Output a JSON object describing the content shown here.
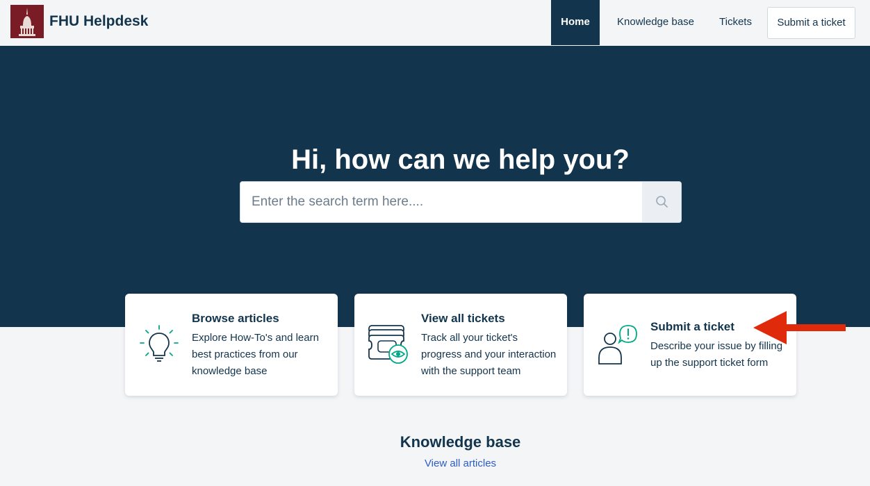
{
  "header": {
    "logo_icon": "building-tower-icon",
    "brand": "FHU Helpdesk",
    "nav": {
      "home": "Home",
      "knowledge_base": "Knowledge base",
      "tickets": "Tickets",
      "submit_ticket": "Submit a ticket"
    }
  },
  "hero": {
    "title": "Hi, how can we help you?",
    "search": {
      "placeholder": "Enter the search term here....",
      "value": "",
      "icon": "search-icon"
    }
  },
  "cards": [
    {
      "icon": "lightbulb-icon",
      "title": "Browse articles",
      "description": "Explore How-To's and learn best practices from our knowledge base"
    },
    {
      "icon": "tickets-eye-icon",
      "title": "View all tickets",
      "description": "Track all your ticket's progress and your interaction with the support team"
    },
    {
      "icon": "person-alert-icon",
      "title": "Submit a ticket",
      "description": "Describe your issue by filling up the support ticket form"
    }
  ],
  "knowledge_base": {
    "title": "Knowledge base",
    "view_all": "View all articles"
  },
  "annotation": {
    "icon": "red-arrow-icon"
  },
  "colors": {
    "navy": "#12344d",
    "logo_bg": "#7a1c25",
    "accent_green": "#00a886",
    "link_blue": "#2c5cc5",
    "annotation_red": "#e02a0c"
  }
}
